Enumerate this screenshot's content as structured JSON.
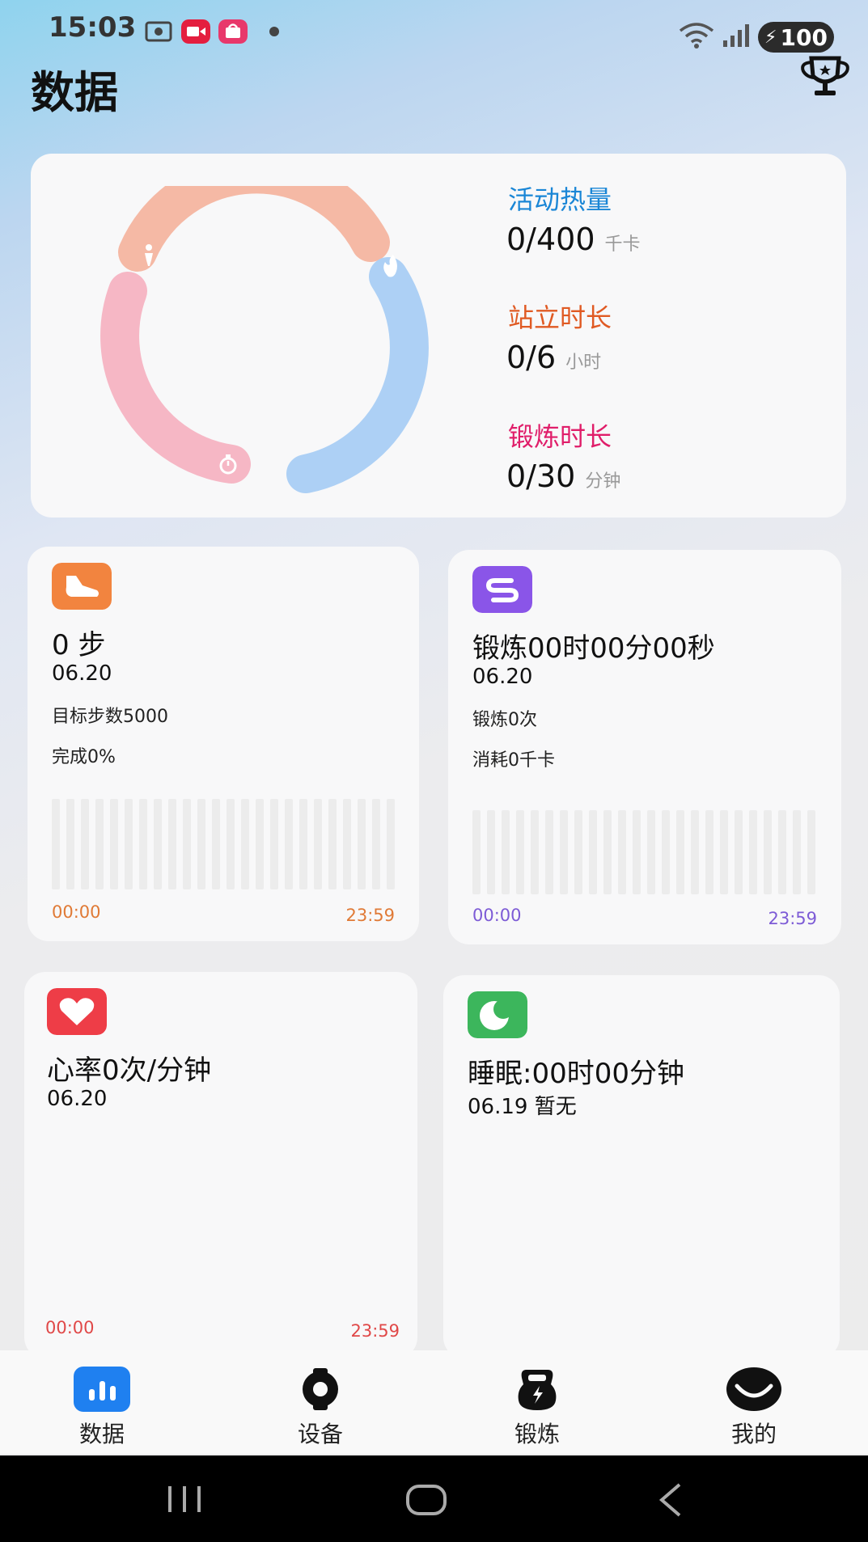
{
  "status": {
    "time": "15:03",
    "battery": "100"
  },
  "header": {
    "title": "数据",
    "trophy_icon": "trophy-icon"
  },
  "summary": {
    "calories": {
      "label": "活动热量",
      "value": "0/400",
      "unit": "千卡",
      "color": "#1a86d6"
    },
    "standing": {
      "label": "站立时长",
      "value": "0/6",
      "unit": "小时",
      "color": "#e05a23"
    },
    "exercise": {
      "label": "锻炼时长",
      "value": "0/30",
      "unit": "分钟",
      "color": "#e01e6a"
    },
    "ring_colors": {
      "standing": "#f5b9a5",
      "calories": "#add0f5",
      "exercise": "#f6b7c5"
    }
  },
  "steps_card": {
    "icon": "shoe-icon",
    "icon_color": "#f2843f",
    "title": "0 步",
    "date": "06.20",
    "goal": "目标步数5000",
    "progress": "完成0%",
    "time_start": "00:00",
    "time_end": "23:59",
    "accent": "#e07a36"
  },
  "workout_card": {
    "icon": "workout-icon",
    "icon_color": "#8a55e8",
    "title": "锻炼00时00分00秒",
    "date": "06.20",
    "count": "锻炼0次",
    "calories": "消耗0千卡",
    "time_start": "00:00",
    "time_end": "23:59",
    "accent": "#7d5bd6"
  },
  "heart_card": {
    "icon": "heart-icon",
    "icon_color": "#ee3d47",
    "title": "心率0次/分钟",
    "date": "06.20",
    "time_start": "00:00",
    "time_end": "23:59",
    "accent": "#e04848"
  },
  "sleep_card": {
    "icon": "moon-icon",
    "icon_color": "#3cb65c",
    "title": "睡眠:00时00分钟",
    "date": "06.19 暂无"
  },
  "nav": {
    "items": [
      {
        "label": "数据",
        "icon": "chart-icon"
      },
      {
        "label": "设备",
        "icon": "watch-icon"
      },
      {
        "label": "锻炼",
        "icon": "kettlebell-icon"
      },
      {
        "label": "我的",
        "icon": "profile-icon"
      }
    ]
  }
}
